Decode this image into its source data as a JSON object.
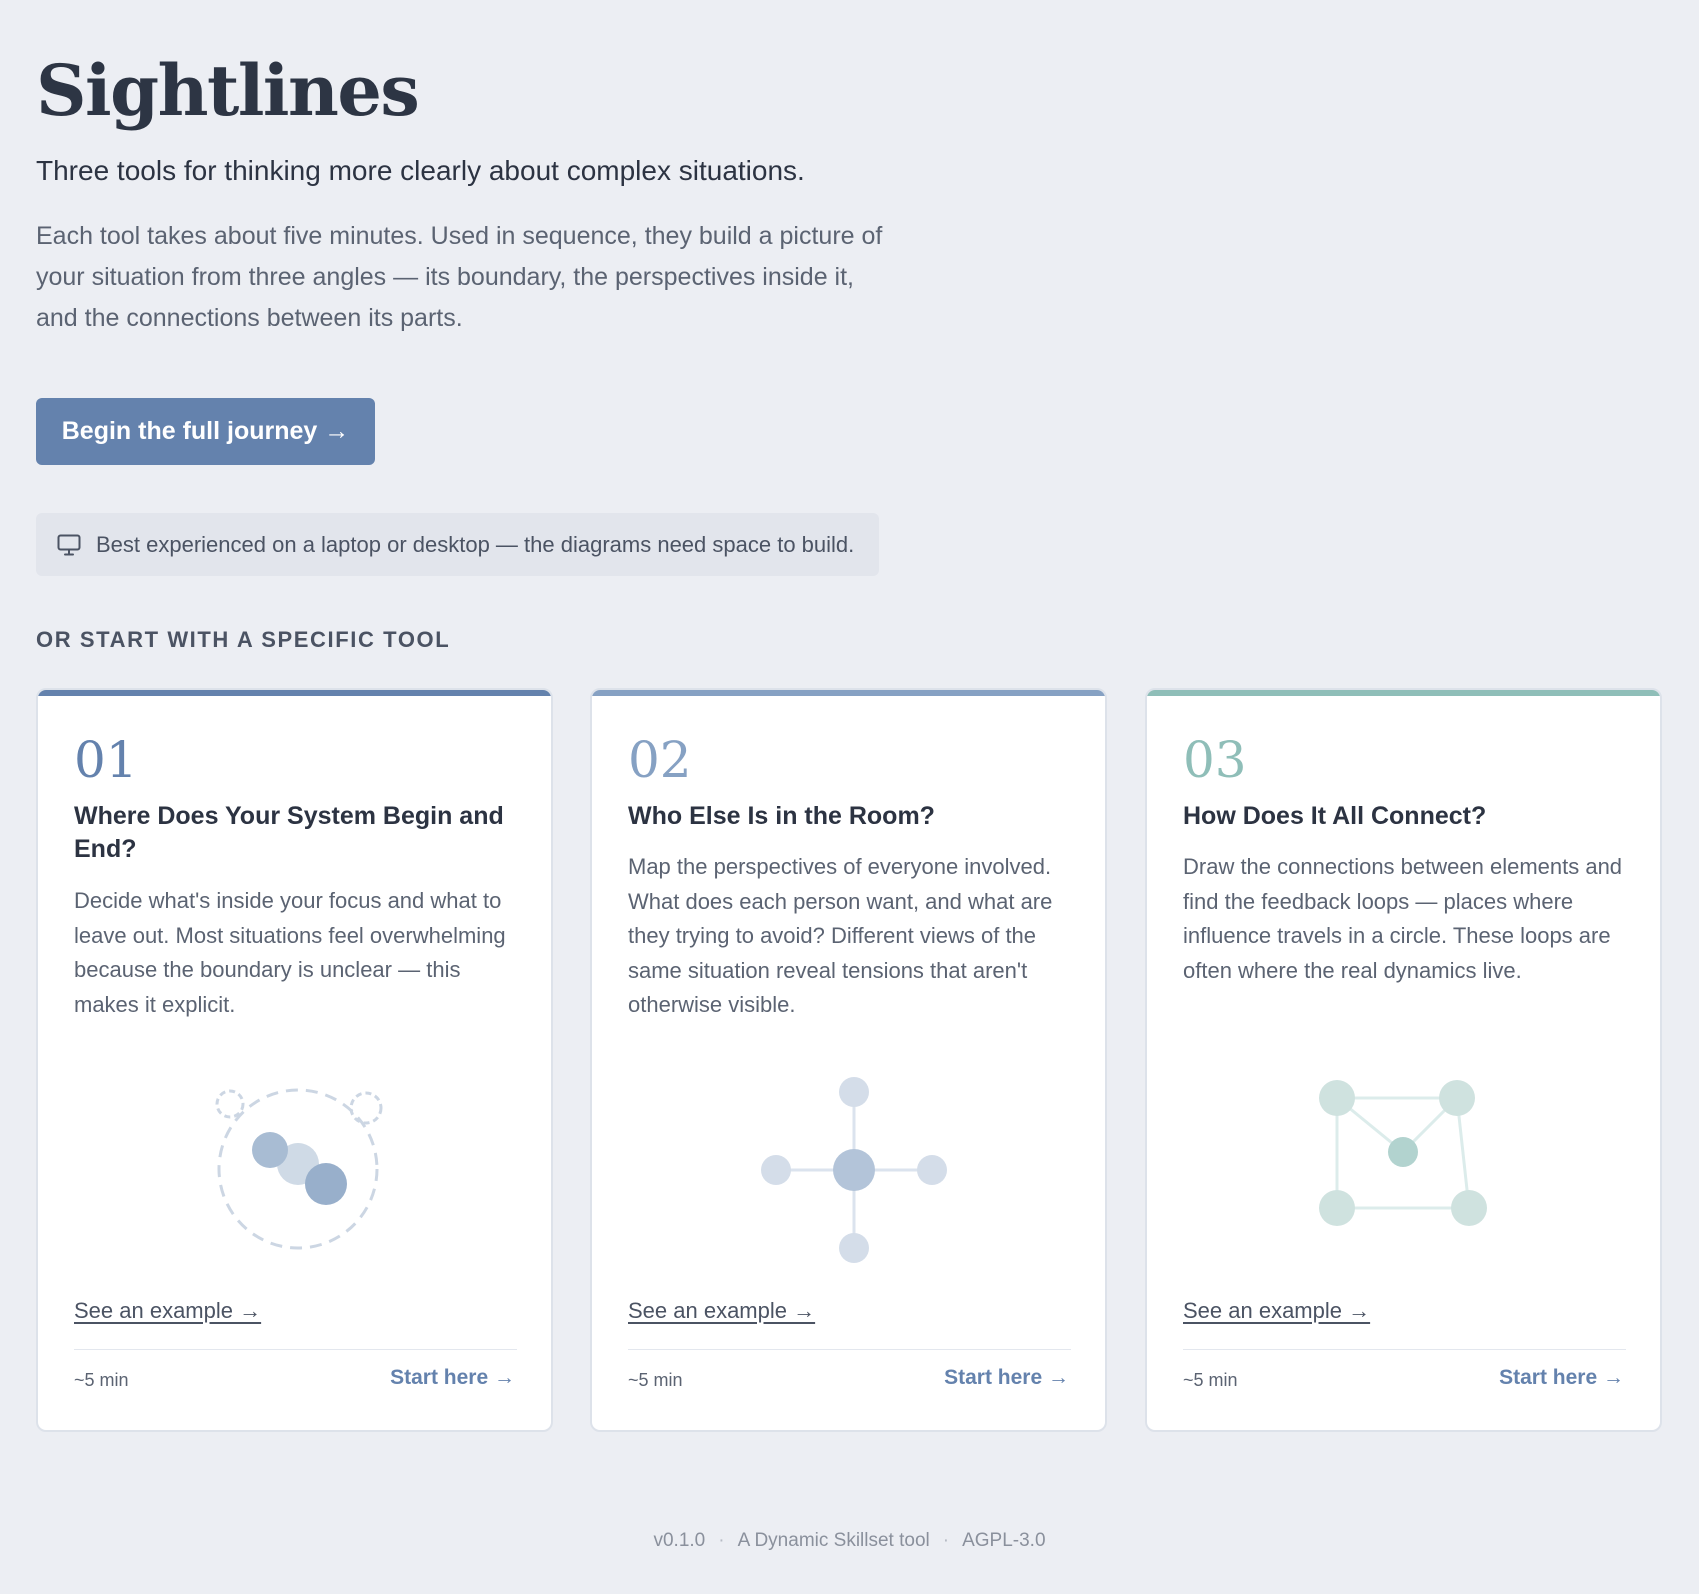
{
  "header": {
    "title": "Sightlines",
    "subtitle": "Three tools for thinking more clearly about complex situations.",
    "intro": "Each tool takes about five minutes. Used in sequence, they build a picture of your situation from three angles — its boundary, the perspectives inside it, and the connections between its parts."
  },
  "cta": {
    "label": "Begin the full journey →"
  },
  "notice": {
    "icon": "monitor-icon",
    "text": "Best experienced on a laptop or desktop — the diagrams need space to build."
  },
  "section": {
    "heading": "OR START WITH A SPECIFIC TOOL"
  },
  "cards": [
    {
      "number": "01",
      "title": "Where Does Your System Begin and End?",
      "description": "Decide what's inside your focus and what to leave out. Most situations feel overwhelming because the boundary is unclear — this makes it explicit.",
      "example_label": "See an example →",
      "time": "~5 min",
      "start_label": "Start here →",
      "accent": "#6482ad",
      "illustration": "boundary-diagram-icon"
    },
    {
      "number": "02",
      "title": "Who Else Is in the Room?",
      "description": "Map the perspectives of everyone involved. What does each person want, and what are they trying to avoid? Different views of the same situation reveal tensions that aren't otherwise visible.",
      "example_label": "See an example →",
      "time": "~5 min",
      "start_label": "Start here →",
      "accent": "#86a1c3",
      "illustration": "perspectives-diagram-icon"
    },
    {
      "number": "03",
      "title": "How Does It All Connect?",
      "description": "Draw the connections between elements and find the feedback loops — places where influence travels in a circle. These loops are often where the real dynamics live.",
      "example_label": "See an example →",
      "time": "~5 min",
      "start_label": "Start here →",
      "accent": "#8fbeb8",
      "illustration": "connections-diagram-icon"
    }
  ],
  "footer": {
    "version": "v0.1.0",
    "tagline": "A Dynamic Skillset tool",
    "license": "AGPL-3.0",
    "separator": "·"
  }
}
